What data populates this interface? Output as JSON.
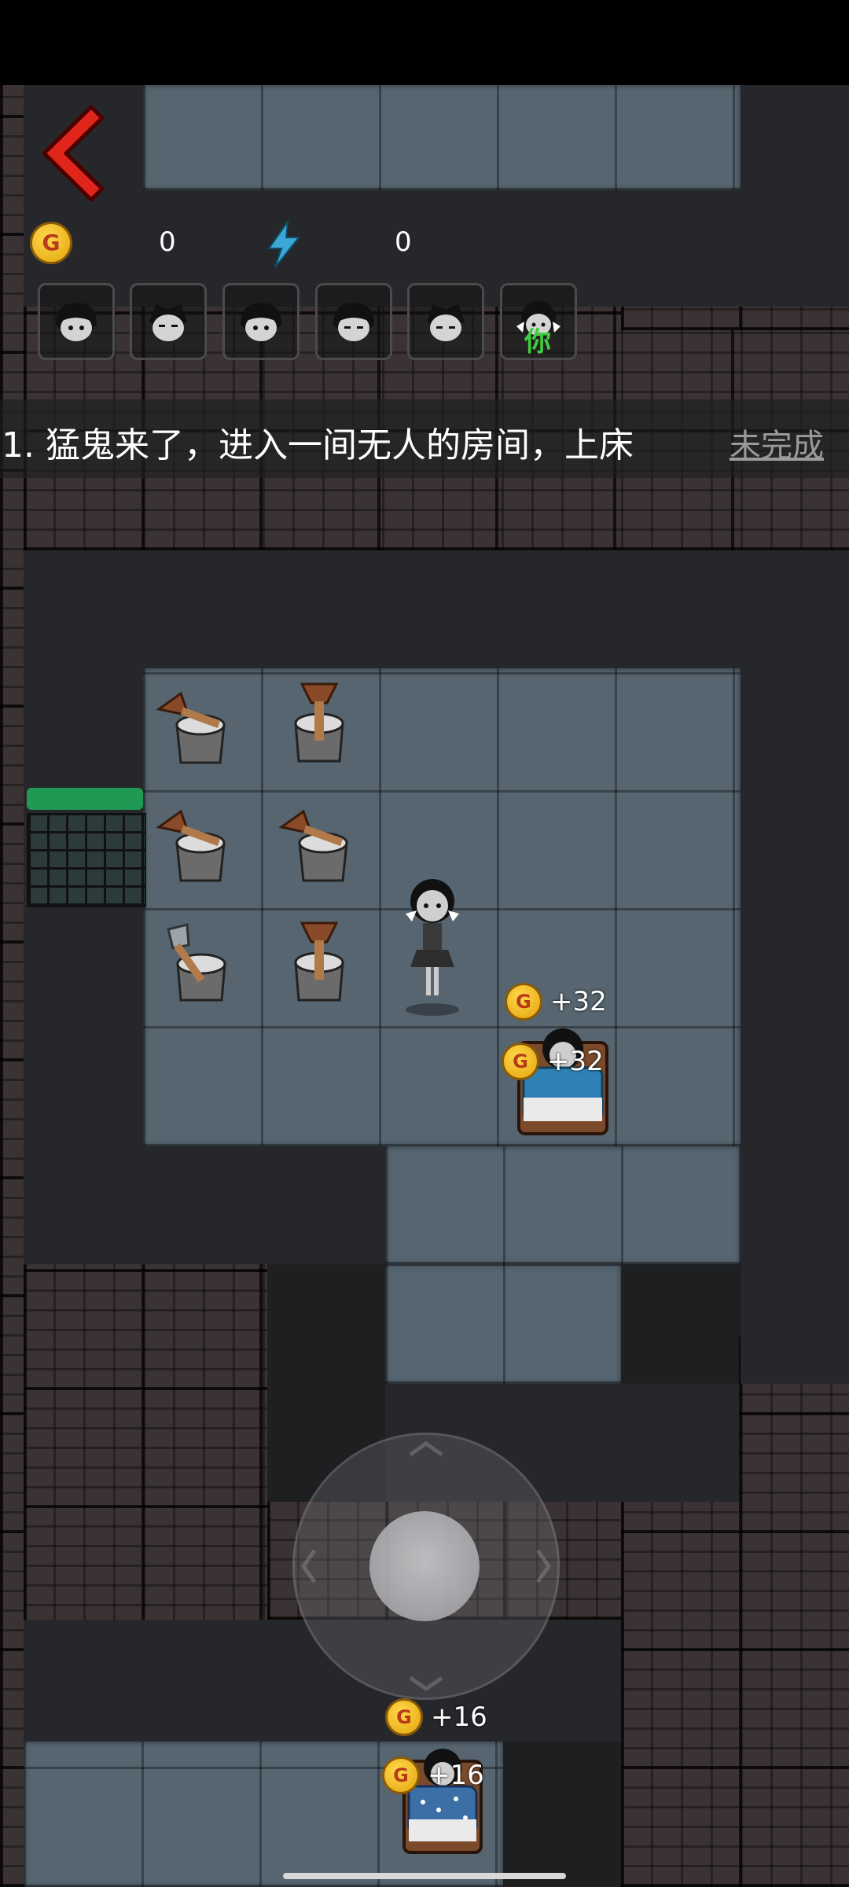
{
  "hud": {
    "coin_icon_label": "G",
    "coin_count": "0",
    "energy_count": "0",
    "back_icon": "back-chevron-icon",
    "energy_icon": "lightning-icon"
  },
  "players": [
    {
      "name": "player-1"
    },
    {
      "name": "player-2"
    },
    {
      "name": "player-3"
    },
    {
      "name": "player-4"
    },
    {
      "name": "player-5"
    },
    {
      "name": "player-6",
      "tag": "你"
    }
  ],
  "task": {
    "text": "1. 猛鬼来了，进入一间无人的房间，上床",
    "status": "未完成"
  },
  "rewards": {
    "bed1_a": "+32",
    "bed1_b": "+32",
    "bed2_a": "+16",
    "bed2_b": "+16"
  },
  "colors": {
    "accent_red": "#e0251b",
    "door_hp": "#1f9a55",
    "you_tag": "#3fcf3f",
    "floor": "#566570",
    "brick": "#3b3333"
  }
}
